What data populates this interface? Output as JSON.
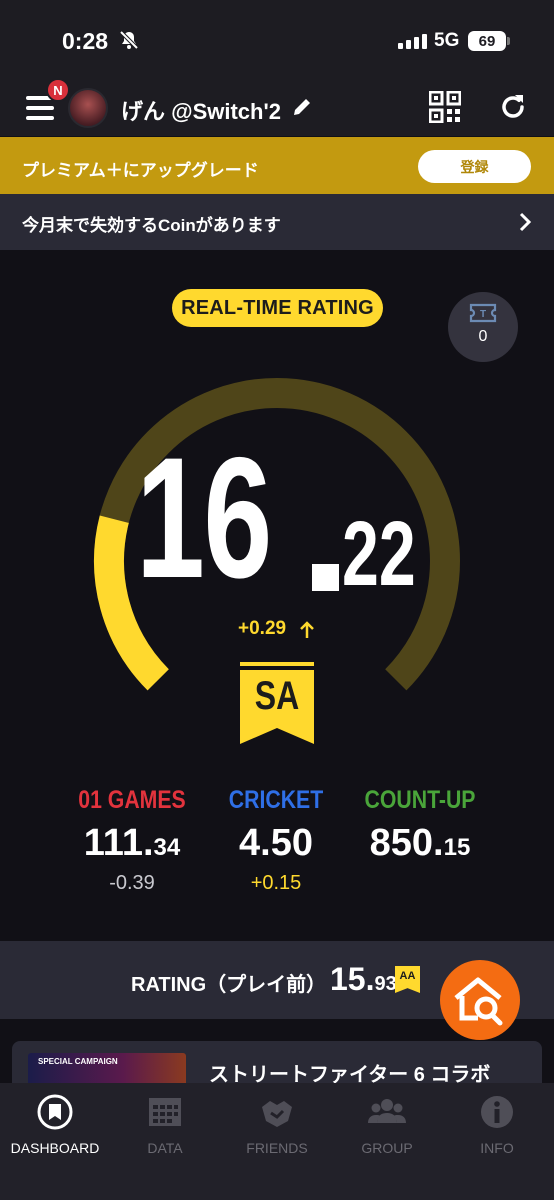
{
  "status_bar": {
    "time": "0:28",
    "network": "5G",
    "battery": "69"
  },
  "header": {
    "badge": "N",
    "user_name": "げん @Switch'2"
  },
  "premium": {
    "text": "プレミアム＋にアップグレード",
    "button": "登録"
  },
  "coin_notice": {
    "text": "今月末で失効するCoinがあります"
  },
  "rating": {
    "label": "REAL-TIME RATING",
    "ticket_count": "0",
    "value_int": "16",
    "value_dec": "22",
    "delta": "+0.29",
    "class": "SA",
    "gauge_fraction": 0.22
  },
  "stats": [
    {
      "label": "01 GAMES",
      "value_int": "111.",
      "value_dec": "34",
      "delta": "-0.39",
      "color": "#e2333d",
      "delta_color": "#c9c9cf"
    },
    {
      "label": "CRICKET",
      "value_int": "4.50",
      "value_dec": "",
      "delta": "+0.15",
      "color": "#2f6fe6",
      "delta_color": "#ffd92e"
    },
    {
      "label": "COUNT-UP",
      "value_int": "850.",
      "value_dec": "15",
      "delta": "",
      "color": "#4aa53a",
      "delta_color": "#c9c9cf"
    }
  ],
  "pre_rating": {
    "label": "RATING（プレイ前）",
    "value_int": "15.",
    "value_dec": "93",
    "class": "AA"
  },
  "campaign": {
    "image_text": "SPECIAL CAMPAIGN",
    "title": "ストリートファイター 6 コラボ"
  },
  "nav": [
    {
      "label": "DASHBOARD",
      "icon": "dashboard-icon",
      "active": true
    },
    {
      "label": "DATA",
      "icon": "calendar-icon"
    },
    {
      "label": "FRIENDS",
      "icon": "friends-icon"
    },
    {
      "label": "GROUP",
      "icon": "group-icon"
    },
    {
      "label": "INFO",
      "icon": "info-icon"
    }
  ],
  "colors": {
    "accent": "#ffd92e",
    "premium": "#c39a10",
    "fab": "#f46c12",
    "background": "#111016"
  }
}
